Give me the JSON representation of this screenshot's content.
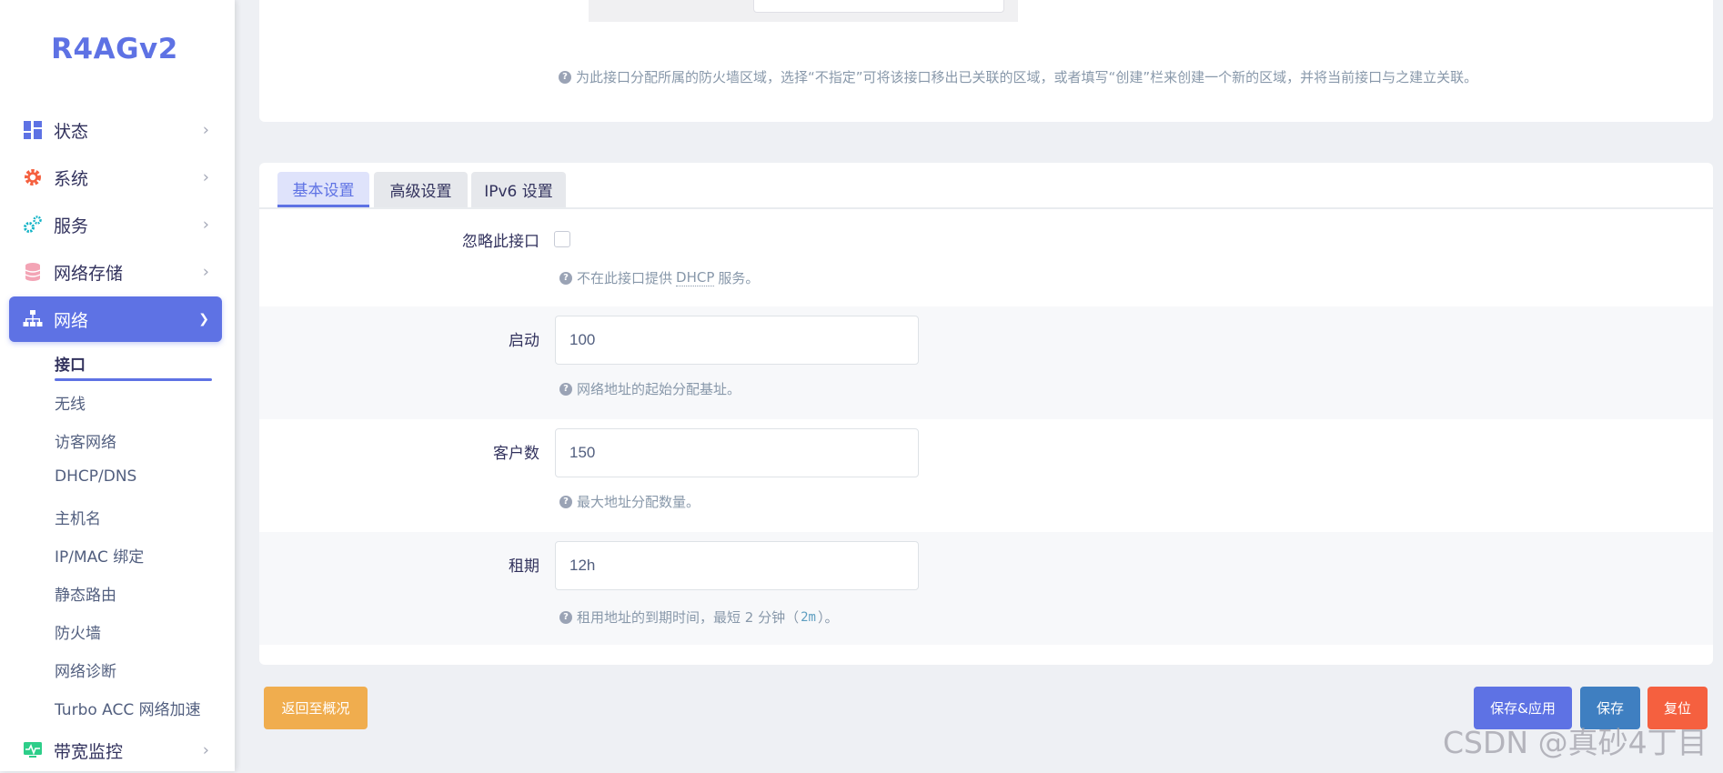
{
  "brand": "R4AGv2",
  "sidebar": {
    "items": [
      {
        "label": "状态",
        "icon": "dashboard-icon"
      },
      {
        "label": "系统",
        "icon": "gear-icon"
      },
      {
        "label": "服务",
        "icon": "services-icon"
      },
      {
        "label": "网络存储",
        "icon": "database-icon"
      },
      {
        "label": "网络",
        "icon": "network-icon"
      },
      {
        "label": "带宽监控",
        "icon": "monitor-icon"
      }
    ],
    "network_sub": [
      "接口",
      "无线",
      "访客网络",
      "DHCP/DNS",
      "主机名",
      "IP/MAC 绑定",
      "静态路由",
      "防火墙",
      "网络诊断",
      "Turbo ACC 网络加速"
    ],
    "active_item": "网络",
    "current_sub": "接口"
  },
  "firewall": {
    "help": "为此接口分配所属的防火墙区域，选择“不指定”可将该接口移出已关联的区域，或者填写“创建”栏来创建一个新的区域，并将当前接口与之建立关联。"
  },
  "tabs": [
    "基本设置",
    "高级设置",
    "IPv6 设置"
  ],
  "active_tab": "基本设置",
  "fields": {
    "ignore": {
      "label": "忽略此接口",
      "help_pre": "不在此接口提供",
      "help_abbr": "DHCP",
      "help_post": "服务。",
      "checked": false
    },
    "start": {
      "label": "启动",
      "value": "100",
      "help": "网络地址的起始分配基址。"
    },
    "limit": {
      "label": "客户数",
      "value": "150",
      "help": "最大地址分配数量。"
    },
    "lease": {
      "label": "租期",
      "value": "12h",
      "help_pre": "租用地址的到期时间，最短 2 分钟（",
      "help_code": "2m",
      "help_post": "）。"
    }
  },
  "buttons": {
    "back": "返回至概况",
    "save_apply": "保存&应用",
    "save": "保存",
    "reset": "复位"
  },
  "watermark": "CSDN @真砂4丁目",
  "colors": {
    "accent": "#5e72e4",
    "warning": "#f0ad4e",
    "save": "#3f7fc1",
    "danger": "#f5603f"
  }
}
